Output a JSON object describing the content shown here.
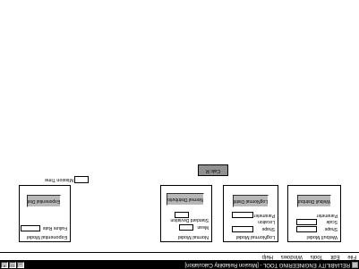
{
  "window": {
    "title": "RELIABILITY ENGINEERING TOOL - [Mission Reliability Calculation]",
    "controls": [
      "_",
      "□",
      "×"
    ]
  },
  "menu": [
    "File",
    "Edit",
    "Tools",
    "Windows",
    "Help"
  ],
  "panels": {
    "weibull": {
      "title": "Weibull Model",
      "shape_label": "Shape",
      "scale_label": "Scale",
      "parameter_label": "Parameter",
      "button": "Weibull Distribution"
    },
    "lognormal": {
      "title": "LogNormal Model",
      "shape_label": "Shape",
      "location_label": "Location",
      "parameter_label": "Parameter",
      "button": "LogNormal Distribution"
    },
    "normal": {
      "title": "Normal Model",
      "mean_label": "Mean",
      "std_label": "Standard Deviation",
      "button": "Normal Distribution"
    },
    "exponential": {
      "title": "Exponential Model",
      "failure_rate_label": "Failure Rate",
      "button": "Exponential Distribution"
    }
  },
  "calc_button": "Calc R",
  "mission_time_label": "Mission Time"
}
